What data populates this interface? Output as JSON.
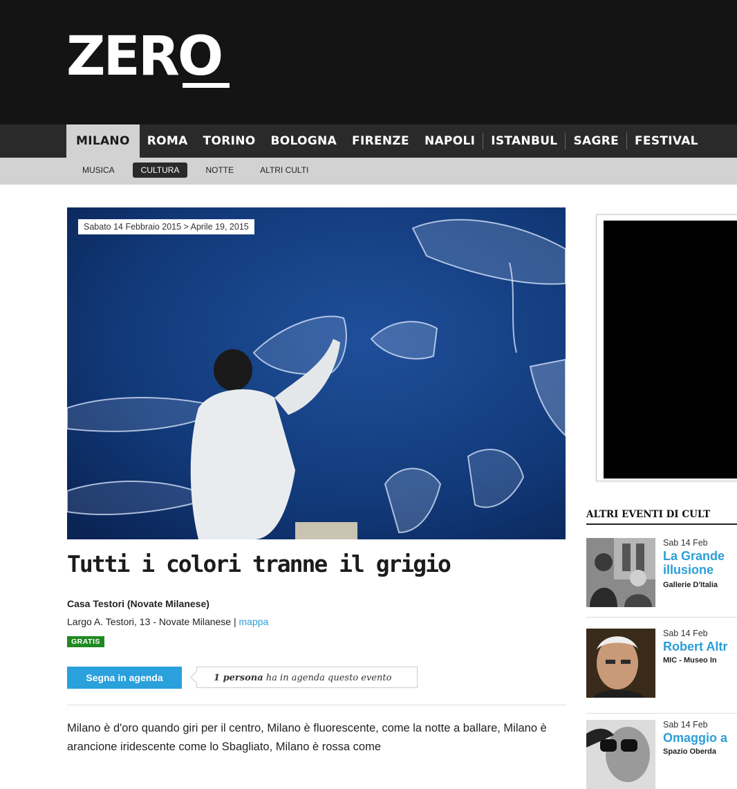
{
  "brand": {
    "logo_text": "ZERO"
  },
  "city_nav": [
    {
      "label": "MILANO",
      "active": true
    },
    {
      "label": "ROMA"
    },
    {
      "label": "TORINO"
    },
    {
      "label": "BOLOGNA"
    },
    {
      "label": "FIRENZE"
    },
    {
      "label": "NAPOLI"
    },
    {
      "label": "ISTANBUL"
    },
    {
      "label": "SAGRE"
    },
    {
      "label": "FESTIVAL"
    }
  ],
  "sub_nav": [
    {
      "label": "MUSICA"
    },
    {
      "label": "CULTURA",
      "active": true
    },
    {
      "label": "NOTTE"
    },
    {
      "label": "ALTRI CULTI"
    }
  ],
  "event": {
    "date_range": "Sabato 14 Febbraio 2015 > Aprile 19, 2015",
    "title": "Tutti i colori tranne il grigio",
    "venue": "Casa Testori (Novate Milanese)",
    "address": "Largo A. Testori, 13 - Novate Milanese",
    "address_sep": " | ",
    "map_link": "mappa",
    "price_badge": "GRATIS",
    "agenda_button": "Segna in agenda",
    "agenda_count_bold": "1 persona",
    "agenda_count_rest": " ha in agenda questo evento",
    "description": "Milano è d'oro quando giri per il centro, Milano è fluorescente, come la notte a ballare, Milano è arancione iridescente come lo Sbagliato, Milano è rossa come"
  },
  "sidebar": {
    "heading": "ALTRI EVENTI DI CULT",
    "events": [
      {
        "date": "Sab 14 Feb",
        "title_line1": "La Grande",
        "title_line2": "illusione",
        "venue": "Gallerie D'Italia"
      },
      {
        "date": "Sab 14 Feb",
        "title_line1": "Robert Altr",
        "title_line2": "",
        "venue": "MIC - Museo In"
      },
      {
        "date": "Sab 14 Feb",
        "title_line1": "Omaggio a",
        "title_line2": "",
        "venue": "Spazio Oberda"
      }
    ]
  },
  "colors": {
    "header_bg": "#141414",
    "nav_bg": "#2a2a2a",
    "subnav_bg": "#d2d2d2",
    "link_blue": "#2a9fd8",
    "button_blue": "#2aa0dc",
    "gratis_green": "#1f8a1f"
  }
}
